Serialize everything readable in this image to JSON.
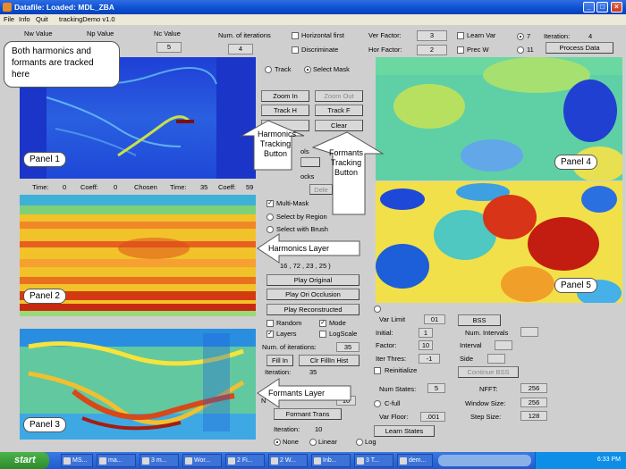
{
  "window": {
    "title": "Datafile: Loaded: MDL_ZBA"
  },
  "menu": [
    "File",
    "Info",
    "Quit",
    "trackingDemo v1.0"
  ],
  "header": {
    "nw_label": "Nw Value",
    "np_label": "Np Value",
    "nc_label": "Nc Value",
    "nc_value": "5",
    "num_iter_label": "Num. of iterations",
    "num_iter_value": "4",
    "horizontal_first": "Horizontal first",
    "discriminate": "Discriminate",
    "ver_factor_label": "Ver Factor:",
    "ver_factor_value": "3",
    "hor_factor_label": "Hor Factor:",
    "hor_factor_value": "2",
    "learn_var": "Learn Var",
    "prec_w": "Prec W",
    "opt7": "7",
    "opt11": "11",
    "iteration_label": "Iteration:",
    "iteration_value": "4",
    "process_data": "Process Data"
  },
  "panels": {
    "p1": "Panel 1",
    "p2": "Panel 2",
    "p3": "Panel 3",
    "p4": "Panel 4",
    "p5": "Panel 5"
  },
  "status_row": {
    "time_label": "Time:",
    "time_value": "0",
    "coeff_label": "Coeff:",
    "coeff_value": "0",
    "chosen_label": "Chosen",
    "time2_label": "Time:",
    "time2_value": "35",
    "coeff2_label": "Coeff:",
    "coeff2_value": "59"
  },
  "controls": {
    "track": "Track",
    "select_mask": "Select Mask",
    "zoom_in": "Zoom In",
    "zoom_out": "Zoom Out",
    "track_h": "Track H",
    "track_f": "Track F",
    "dele": "Dele",
    "clear": "Clear",
    "frag_a": "ols",
    "frag_b": "ocks",
    "frag_c": "Dele",
    "multi_mask": "Multi-Mask",
    "select_by_region": "Select by Region",
    "select_with_brush": "Select with Brush",
    "layer_values": "16 , 72 , 23 , 25 )",
    "play_original": "Play Original",
    "play_ori_occlusion": "Play Ori Occlusion",
    "play_reconstructed": "Play Reconstructed",
    "random": "Random",
    "mode": "Mode",
    "layers": "Layers",
    "logscale": "LogScale",
    "num_iterations_label": "Num. of iterations:",
    "num_iterations_value": "35",
    "fill_in": "Fill In",
    "clr_fill_in_hist": "Clr FillIn Hist",
    "iteration_label": "Iteration:",
    "iteration_value": "35",
    "n_label": "N",
    "ten_value": "10",
    "formant_trans": "Formant Trans",
    "iteration2_label": "Iteration:",
    "iteration2_value": "10",
    "none": "None",
    "linear": "Linear",
    "log": "Log"
  },
  "right_controls": {
    "var_limit_label": "Var Limit",
    "var_limit_value": "01",
    "bss": "BSS",
    "initial_label": "Initial:",
    "initial_value": "1",
    "num_intervals_label": "Num. Intervals",
    "factor_label": "Factor:",
    "factor_value": "10",
    "interval_label": "Interval",
    "iter_thres_label": "Iter Thres:",
    "iter_thres_value": "-1",
    "side_label": "Side",
    "reinitialize": "Reinitialize",
    "continue_bss": "Continue BSS",
    "num_states_label": "Num States:",
    "num_states_value": "5",
    "nfft_label": "NFFT:",
    "nfft_value": "256",
    "c_full": "C-full",
    "window_size_label": "Window Size:",
    "window_size_value": "256",
    "var_floor_label": "Var Floor:",
    "var_floor_value": ".001",
    "step_size_label": "Step Size:",
    "step_size_value": "128",
    "learn_states": "Learn States"
  },
  "callouts": {
    "both": "Both harmonics and formants are tracked here",
    "harmonics_btn": "Harmonics Tracking Button",
    "formants_btn": "Formants Tracking Button",
    "harmonics_layer": "Harmonics Layer",
    "formants_layer": "Formants Layer"
  },
  "taskbar": {
    "start": "start",
    "tasks": [
      "MS...",
      "ma...",
      "3 m...",
      "Wor...",
      "2 Fi...",
      "2 W...",
      "Inb...",
      "3 T...",
      "dem..."
    ],
    "clock": "6:33 PM"
  }
}
